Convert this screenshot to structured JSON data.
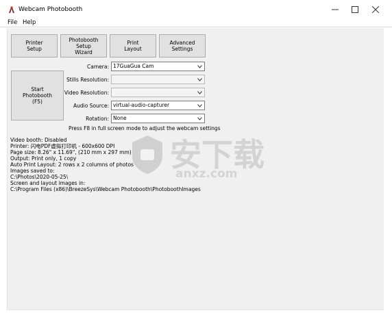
{
  "window": {
    "title": "Webcam Photobooth"
  },
  "menu": {
    "file": "File",
    "help": "Help"
  },
  "toolbar": {
    "printer_setup": "Printer\nSetup",
    "photobooth_setup": "Photobooth\nSetup\nWizard",
    "print_layout": "Print\nLayout",
    "advanced_settings": "Advanced\nSettings"
  },
  "start_button": "Start\nPhotobooth\n(F5)",
  "settings": {
    "camera": {
      "label": "Camera:",
      "value": "17GuaGua Cam"
    },
    "stills_resolution": {
      "label": "Stills Resolution:",
      "value": ""
    },
    "video_resolution": {
      "label": "Video Resolution:",
      "value": ""
    },
    "audio_source": {
      "label": "Audio Source:",
      "value": "virtual-audio-capturer"
    },
    "rotation": {
      "label": "Rotation:",
      "value": "None"
    }
  },
  "hint": "Press F8 in full screen mode to adjust the webcam settings",
  "info_lines": [
    "Video booth: Disabled",
    "Printer: 闪电PDF虚拟打印机 - 600x600 DPI",
    "Page size: 8.26\" x 11.69\", (210 mm x 297 mm)",
    "Output: Print only, 1 copy",
    "Auto Print Layout: 2 rows x 2 columns of photos",
    "Images saved to:",
    "C:\\Photos\\2020-05-25\\",
    "Screen and layout images in:",
    "C:\\Program Files (x86)\\BreezeSys\\Webcam Photobooth\\PhotoboothImages"
  ],
  "watermark": {
    "main": "安下载",
    "sub": "anxz.com"
  },
  "icons": {
    "app": "app-icon",
    "minimize": "minimize-icon",
    "maximize": "maximize-icon",
    "close": "close-icon",
    "dropdown": "chevron-down-icon"
  }
}
